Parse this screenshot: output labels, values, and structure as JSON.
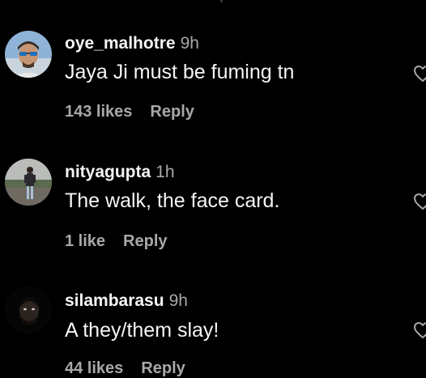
{
  "colors": {
    "background": "#000000",
    "primary_text": "#f5f5f5",
    "secondary_text": "#a8a8a8"
  },
  "comments": [
    {
      "username": "oye_malhotre",
      "time": "9h",
      "text": "Jaya Ji must be fuming tn",
      "likes": "143 likes",
      "reply_label": "Reply",
      "avatar_icon": "avatar-photo-sunglasses",
      "like_icon": "heart-outline-icon"
    },
    {
      "username": "nityagupta",
      "time": "1h",
      "text": "The walk, the face card.",
      "likes": "1 like",
      "reply_label": "Reply",
      "avatar_icon": "avatar-photo-standing-figure",
      "like_icon": "heart-outline-icon"
    },
    {
      "username": "silambarasu",
      "time": "9h",
      "text": "A they/them slay!",
      "likes": "44 likes",
      "reply_label": "Reply",
      "avatar_icon": "avatar-photo-dark-face",
      "like_icon": "heart-outline-icon"
    }
  ]
}
